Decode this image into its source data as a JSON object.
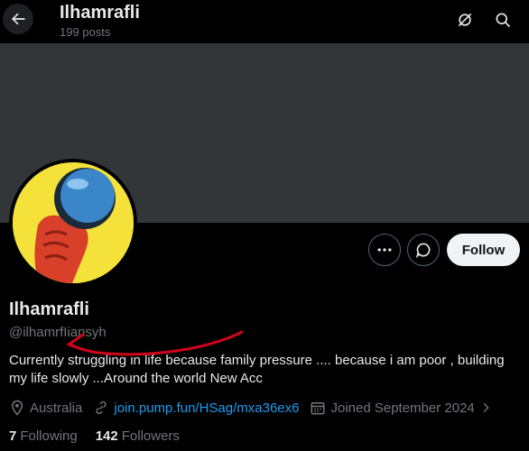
{
  "header": {
    "title": "Ilhamrafli",
    "posts_count": "199 posts"
  },
  "profile": {
    "display_name": "Ilhamrafli",
    "handle": "@ilhamrfIiansyh",
    "bio": "Currently struggling in life because family pressure .... because i am poor , building my life slowly ...Around the world New Acc",
    "location": "Australia",
    "website": "join.pump.fun/HSag/mxa36ex6",
    "joined": "Joined September 2024",
    "following_count": "7",
    "following_label": "Following",
    "followers_count": "142",
    "followers_label": "Followers"
  },
  "actions": {
    "follow_label": "Follow"
  },
  "icons": {
    "back": "arrow-left-icon",
    "grok": "grok-icon",
    "search": "search-icon",
    "more": "more-icon",
    "message": "message-icon",
    "location": "location-pin-icon",
    "link": "link-icon",
    "calendar": "calendar-icon"
  },
  "colors": {
    "background": "#000000",
    "banner": "#333639",
    "link": "#1d9bf0",
    "muted": "#71767b",
    "annotation": "#d0021b"
  }
}
